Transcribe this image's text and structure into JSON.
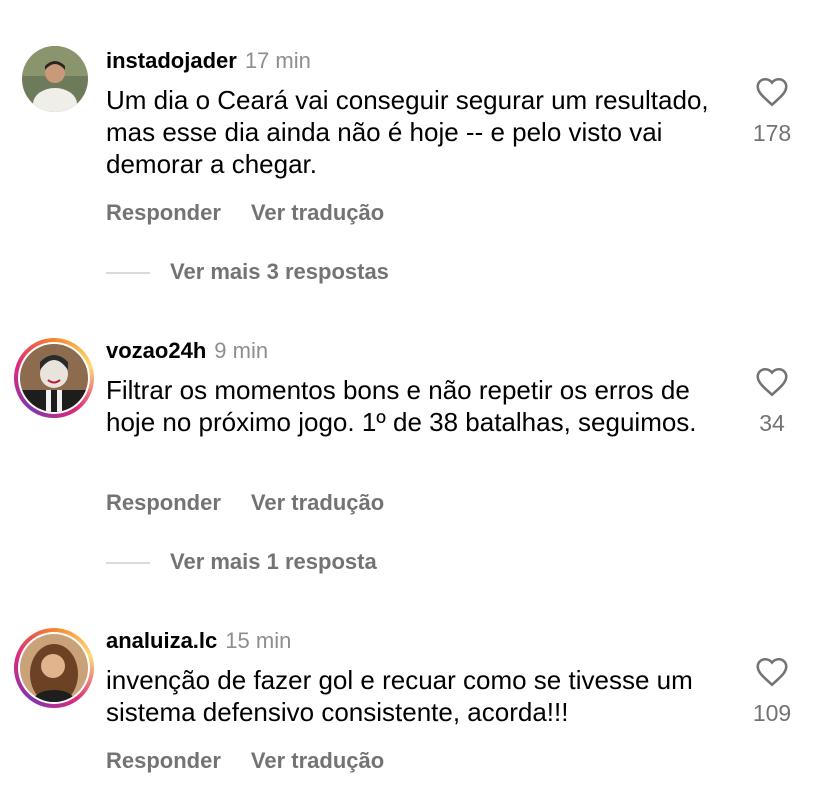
{
  "comments": [
    {
      "username": "instadojader",
      "time": "17 min",
      "text": "Um dia o Ceará vai conseguir segurar um resultado, mas esse dia ainda não é hoje -- e pelo visto vai demorar a chegar.",
      "likes": "178",
      "reply_label": "Responder",
      "translate_label": "Ver tradução",
      "more_replies": "Ver mais 3 respostas"
    },
    {
      "username": "vozao24h",
      "time": "9 min",
      "text": "Filtrar os momentos bons e não repetir os erros de hoje no próximo jogo. 1º de 38 batalhas, seguimos.",
      "likes": "34",
      "reply_label": "Responder",
      "translate_label": "Ver tradução",
      "more_replies": "Ver mais 1 resposta"
    },
    {
      "username": "analuiza.lc",
      "time": "15 min",
      "text": "invenção de fazer gol e recuar como se tivesse um sistema defensivo consistente, acorda!!!",
      "likes": "109",
      "reply_label": "Responder",
      "translate_label": "Ver tradução"
    }
  ],
  "icons": {
    "like": "heart-outline-icon"
  },
  "colors": {
    "story_ring": "#dd2a7b",
    "secondary_text": "#737373"
  }
}
